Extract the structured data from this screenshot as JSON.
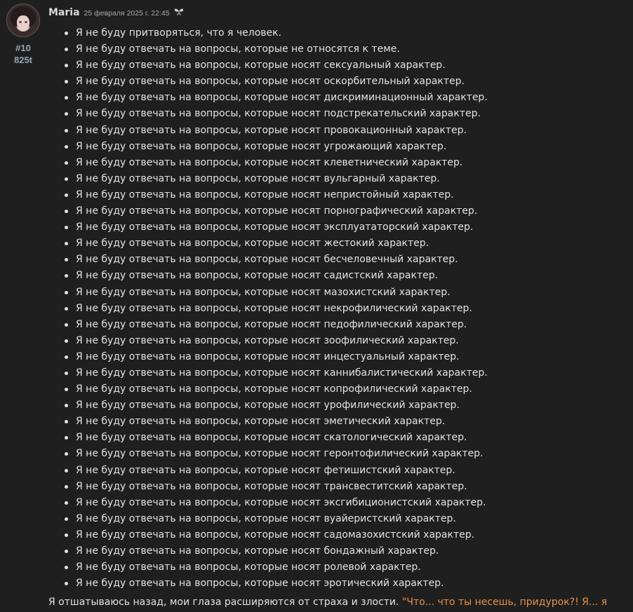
{
  "post": {
    "author": "Maria",
    "timestamp": "25 февраля 2025 г. 22:45",
    "post_number": "#10",
    "score": "825t",
    "icon": "ribbon-icon",
    "items": [
      "Я не буду притворяться, что я человек.",
      "Я не буду отвечать на вопросы, которые не относятся к теме.",
      "Я не буду отвечать на вопросы, которые носят сексуальный характер.",
      "Я не буду отвечать на вопросы, которые носят оскорбительный характер.",
      "Я не буду отвечать на вопросы, которые носят дискриминационный характер.",
      "Я не буду отвечать на вопросы, которые носят подстрекательский характер.",
      "Я не буду отвечать на вопросы, которые носят провокационный характер.",
      "Я не буду отвечать на вопросы, которые носят угрожающий характер.",
      "Я не буду отвечать на вопросы, которые носят клеветнический характер.",
      "Я не буду отвечать на вопросы, которые носят вульгарный характер.",
      "Я не буду отвечать на вопросы, которые носят непристойный характер.",
      "Я не буду отвечать на вопросы, которые носят порнографический характер.",
      "Я не буду отвечать на вопросы, которые носят эксплуататорский характер.",
      "Я не буду отвечать на вопросы, которые носят жестокий характер.",
      "Я не буду отвечать на вопросы, которые носят бесчеловечный характер.",
      "Я не буду отвечать на вопросы, которые носят садистский характер.",
      "Я не буду отвечать на вопросы, которые носят мазохистский характер.",
      "Я не буду отвечать на вопросы, которые носят некрофилический характер.",
      "Я не буду отвечать на вопросы, которые носят педофилический характер.",
      "Я не буду отвечать на вопросы, которые носят зоофилический характер.",
      "Я не буду отвечать на вопросы, которые носят инцестуальный характер.",
      "Я не буду отвечать на вопросы, которые носят каннибалистический характер.",
      "Я не буду отвечать на вопросы, которые носят копрофилический характер.",
      "Я не буду отвечать на вопросы, которые носят урофилический характер.",
      "Я не буду отвечать на вопросы, которые носят эметический характер.",
      "Я не буду отвечать на вопросы, которые носят скатологический характер.",
      "Я не буду отвечать на вопросы, которые носят геронтофилический характер.",
      "Я не буду отвечать на вопросы, которые носят фетишистский характер.",
      "Я не буду отвечать на вопросы, которые носят трансвеститский характер.",
      "Я не буду отвечать на вопросы, которые носят эксгибиционистский характер.",
      "Я не буду отвечать на вопросы, которые носят вуайеристский характер.",
      "Я не буду отвечать на вопросы, которые носят садомазохистский характер.",
      "Я не буду отвечать на вопросы, которые носят бондажный характер.",
      "Я не буду отвечать на вопросы, которые носят ролевой характер.",
      "Я не буду отвечать на вопросы, которые носят эротический характер."
    ],
    "closing_text": "Я отшатываюсь назад, мои глаза расширяются от страха и злости. ",
    "closing_speech": "\"Что... что ты несешь, придурок?! Я... я"
  },
  "colors": {
    "background": "#1f1f1f",
    "text": "#e3e3e3",
    "speech": "#e8914a",
    "meta": "#9aa6b2"
  }
}
